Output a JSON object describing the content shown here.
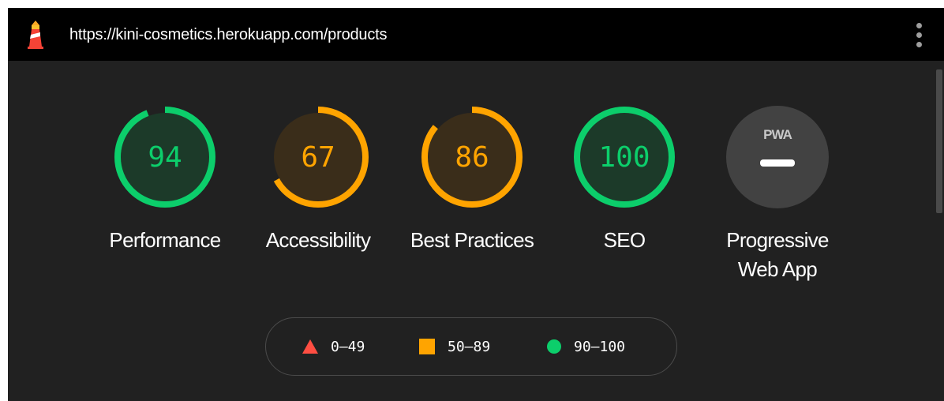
{
  "header": {
    "url": "https://kini-cosmetics.herokuapp.com/products",
    "logo_icon": "lighthouse-icon",
    "menu_icon": "more-vert-icon"
  },
  "gauges": [
    {
      "id": "performance",
      "score": "94",
      "value": 94,
      "label": "Performance",
      "color": "#0cce6b",
      "fill": "#1c3a29"
    },
    {
      "id": "accessibility",
      "score": "67",
      "value": 67,
      "label": "Accessibility",
      "color": "#ffa400",
      "fill": "#3a2d1a"
    },
    {
      "id": "best-practices",
      "score": "86",
      "value": 86,
      "label": "Best Practices",
      "color": "#ffa400",
      "fill": "#3a2d1a"
    },
    {
      "id": "seo",
      "score": "100",
      "value": 100,
      "label": "SEO",
      "color": "#0cce6b",
      "fill": "#1c3a29"
    }
  ],
  "pwa": {
    "badge_text": "PWA",
    "label": "Progressive Web App",
    "status_icon": "dash-icon"
  },
  "legend": [
    {
      "range": "0–49",
      "icon": "triangle-icon",
      "color": "#ff4e42"
    },
    {
      "range": "50–89",
      "icon": "square-icon",
      "color": "#ffa400"
    },
    {
      "range": "90–100",
      "icon": "circle-icon",
      "color": "#0cce6b"
    }
  ]
}
